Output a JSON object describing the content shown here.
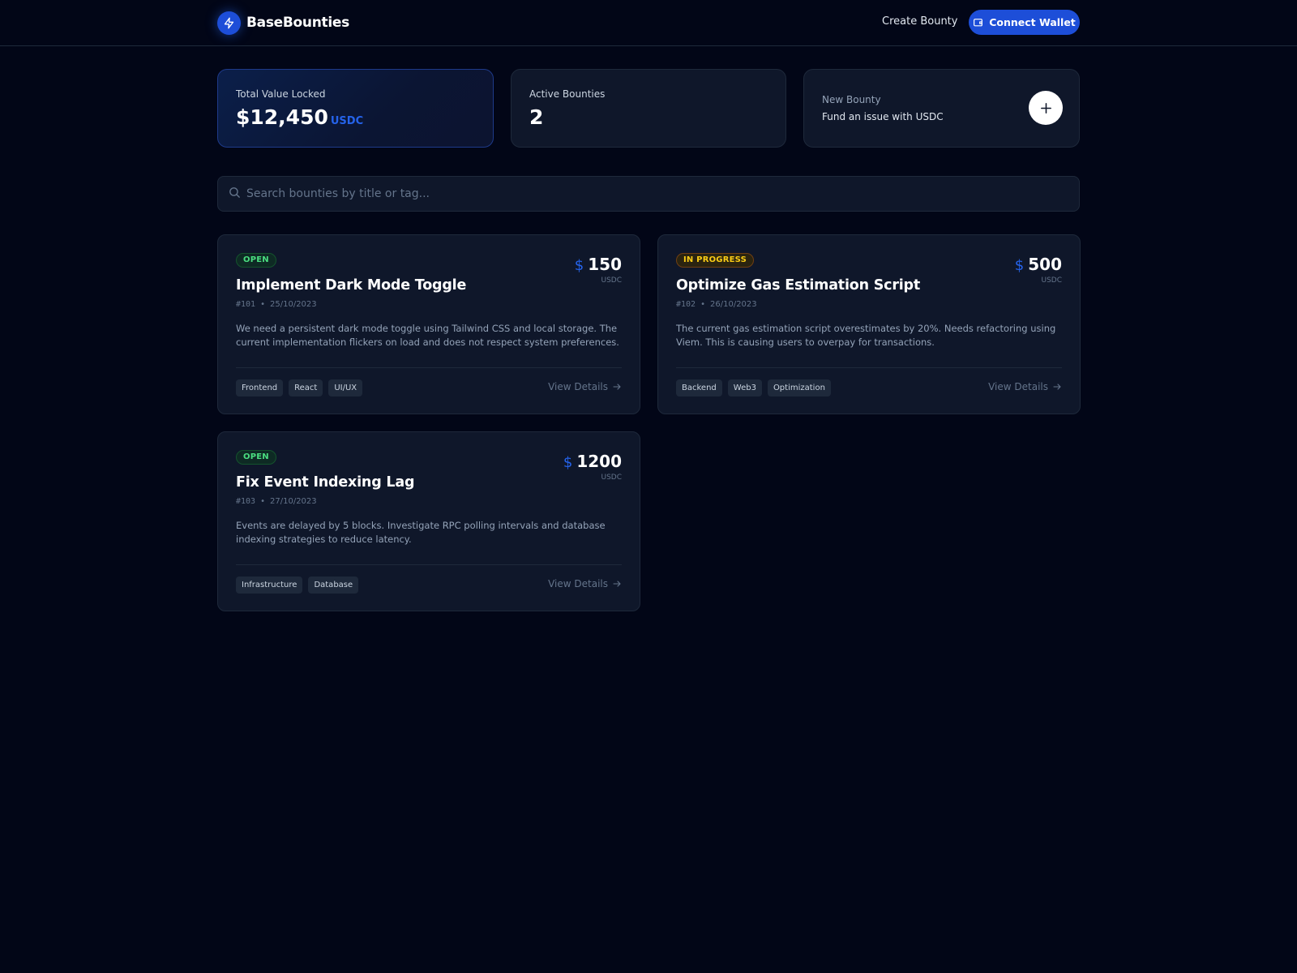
{
  "header": {
    "brand": "BaseBounties",
    "nav_create": "Create Bounty",
    "connect_wallet": "Connect Wallet"
  },
  "stats": {
    "tvl_label": "Total Value Locked",
    "tvl_value": "$12,450",
    "tvl_unit": "USDC",
    "active_label": "Active Bounties",
    "active_value": "2",
    "new_title": "New Bounty",
    "new_subtitle": "Fund an issue with USDC"
  },
  "search": {
    "placeholder": "Search bounties by title or tag..."
  },
  "colors": {
    "background": "#020617",
    "card": "#0f172a",
    "accent": "#1d4ed8",
    "open": "#4ade80",
    "in_progress": "#facc15"
  },
  "bounties": [
    {
      "status": "OPEN",
      "amount": "150",
      "currency": "USDC",
      "title": "Implement Dark Mode Toggle",
      "id": "#101",
      "date": "25/10/2023",
      "description": "We need a persistent dark mode toggle using Tailwind CSS and local storage. The current implementation flickers on load and does not respect system preferences.",
      "tags": [
        "Frontend",
        "React",
        "UI/UX"
      ],
      "action": "View Details"
    },
    {
      "status": "IN PROGRESS",
      "amount": "500",
      "currency": "USDC",
      "title": "Optimize Gas Estimation Script",
      "id": "#102",
      "date": "26/10/2023",
      "description": "The current gas estimation script overestimates by 20%. Needs refactoring using Viem. This is causing users to overpay for transactions.",
      "tags": [
        "Backend",
        "Web3",
        "Optimization"
      ],
      "action": "View Details"
    },
    {
      "status": "OPEN",
      "amount": "1200",
      "currency": "USDC",
      "title": "Fix Event Indexing Lag",
      "id": "#103",
      "date": "27/10/2023",
      "description": "Events are delayed by 5 blocks. Investigate RPC polling intervals and database indexing strategies to reduce latency.",
      "tags": [
        "Infrastructure",
        "Database"
      ],
      "action": "View Details"
    }
  ]
}
